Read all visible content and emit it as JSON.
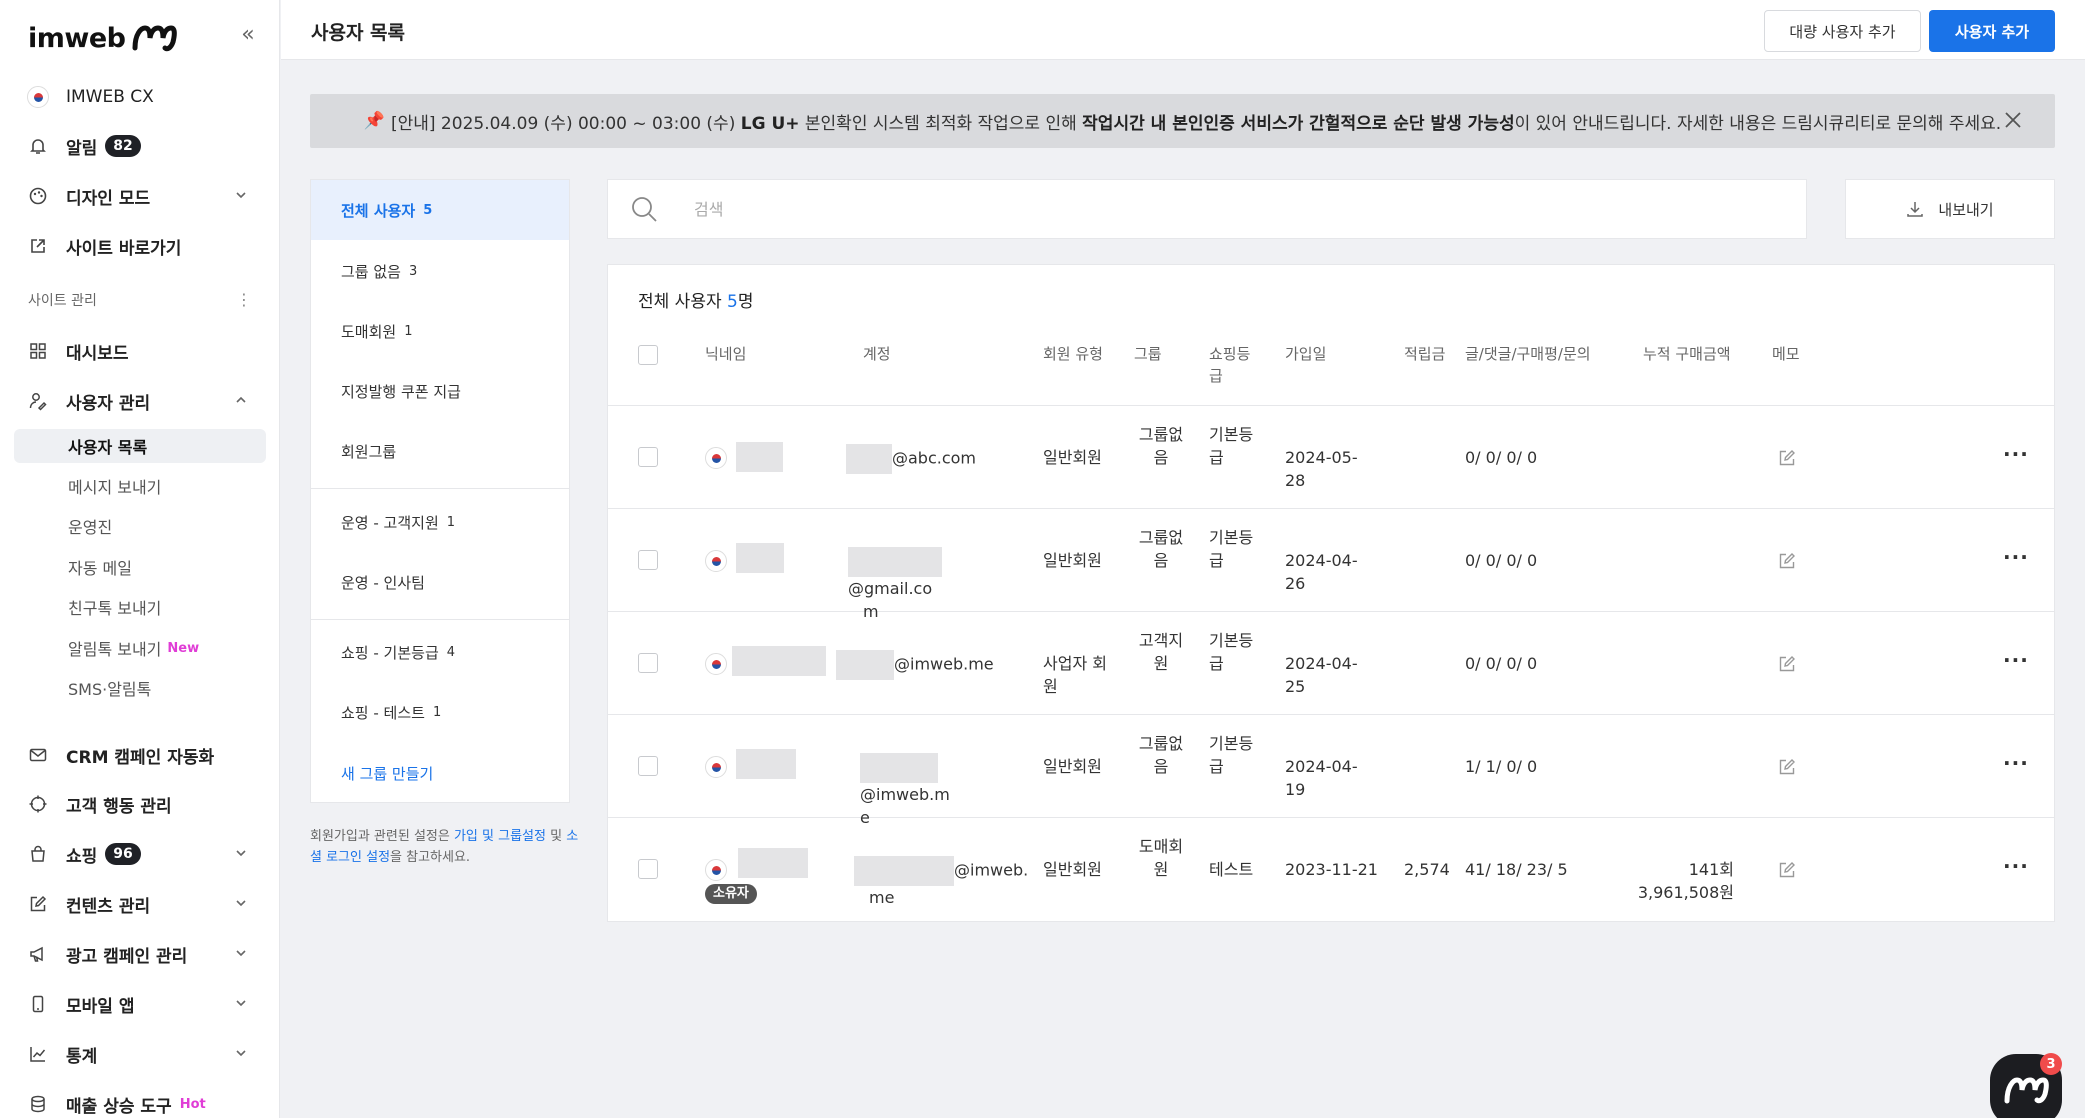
{
  "app": {
    "brand": "imweb",
    "site_name": "IMWEB CX"
  },
  "sidebar": {
    "alarm": {
      "label": "알림",
      "count": "82"
    },
    "design_mode": "디자인 모드",
    "site_shortcut": "사이트 바로가기",
    "section_label": "사이트 관리",
    "dashboard": "대시보드",
    "user_mgmt": "사용자 관리",
    "sub_items": [
      {
        "label": "사용자 목록"
      },
      {
        "label": "메시지 보내기"
      },
      {
        "label": "운영진"
      },
      {
        "label": "자동 메일"
      },
      {
        "label": "친구톡 보내기"
      },
      {
        "label": "알림톡 보내기",
        "tag": "New"
      },
      {
        "label": "SMS·알림톡"
      }
    ],
    "crm": "CRM 캠페인 자동화",
    "behavior": "고객 행동 관리",
    "shopping": {
      "label": "쇼핑",
      "count": "96"
    },
    "content": "컨텐츠 관리",
    "ads": "광고 캠페인 관리",
    "mobile": "모바일 앱",
    "stats": "통계",
    "sales": {
      "label": "매출 상승 도구",
      "tag": "Hot"
    }
  },
  "header": {
    "title": "사용자 목록",
    "bulk_add": "대량 사용자 추가",
    "add_user": "사용자 추가"
  },
  "notice": {
    "pin": "📌",
    "part1": "[안내] 2025.04.09 (수) 00:00 ~ 03:00 (수) ",
    "part2": "LG U+",
    "part3": " 본인확인 시스템 최적화 작업으로 인해 ",
    "part4": "작업시간 내 본인인증 서비스가 간헐적으로 순단 발생 가능성",
    "part5": "이 있어 안내드립니다. 자세한 내용은 드림시큐리티로 문의해 주세요."
  },
  "groups": {
    "items": [
      {
        "label": "전체 사용자",
        "count": "5"
      },
      {
        "label": "그룹 없음",
        "count": "3"
      },
      {
        "label": "도매회원",
        "count": "1"
      },
      {
        "label": "지정발행 쿠폰 지급",
        "count": ""
      },
      {
        "label": "회원그룹",
        "count": ""
      },
      {
        "label": "운영 - 고객지원",
        "count": "1"
      },
      {
        "label": "운영 - 인사팀",
        "count": ""
      },
      {
        "label": "쇼핑 - 기본등급",
        "count": "4"
      },
      {
        "label": "쇼핑 - 테스트",
        "count": "1"
      }
    ],
    "new_group": "새 그룹 만들기",
    "help": {
      "p1": "회원가입과 관련된 설정은 ",
      "link1": "가입 및 그룹설정",
      "p2": " 및 ",
      "link2": "소셜 로그인 설정",
      "p3": "을 참고하세요."
    }
  },
  "search": {
    "placeholder": "검색"
  },
  "export": {
    "label": "내보내기"
  },
  "table": {
    "title_prefix": "전체 사용자 ",
    "count": "5",
    "title_suffix": "명",
    "headers": {
      "nickname": "닉네임",
      "account": "계정",
      "member_type": "회원 유형",
      "group": "그룹",
      "shop_grade": "쇼핑등급",
      "joined": "가입일",
      "points": "적립금",
      "posts": "글/댓글/구매평/문의",
      "total_purchase": "누적 구매금액",
      "memo": "메모"
    },
    "rows": [
      {
        "account_suffix": "@abc.com",
        "account_wrap": "",
        "member_type": "일반회원",
        "group": "그룹없음",
        "grade": "기본등급",
        "joined": "2024-05-28",
        "points": "",
        "posts": "0/ 0/ 0/ 0",
        "purchase_count": "",
        "purchase_amount": "",
        "owner": ""
      },
      {
        "account_suffix": "@gmail.co",
        "account_wrap": "m",
        "member_type": "일반회원",
        "group": "그룹없음",
        "grade": "기본등급",
        "joined": "2024-04-26",
        "points": "",
        "posts": "0/ 0/ 0/ 0",
        "purchase_count": "",
        "purchase_amount": "",
        "owner": ""
      },
      {
        "account_suffix": "@imweb.me",
        "account_wrap": "",
        "member_type": "사업자 회원",
        "group": "고객지원",
        "grade": "기본등급",
        "joined": "2024-04-25",
        "points": "",
        "posts": "0/ 0/ 0/ 0",
        "purchase_count": "",
        "purchase_amount": "",
        "owner": ""
      },
      {
        "account_suffix": "@imweb.m",
        "account_wrap": "e",
        "member_type": "일반회원",
        "group": "그룹없음",
        "grade": "기본등급",
        "joined": "2024-04-19",
        "points": "",
        "posts": "1/ 1/ 0/ 0",
        "purchase_count": "",
        "purchase_amount": "",
        "owner": ""
      },
      {
        "account_suffix": "@imweb.",
        "account_wrap": "me",
        "member_type": "일반회원",
        "group": "도매회원",
        "grade": "테스트",
        "joined": "2023-11-21",
        "points": "2,574",
        "posts": "41/ 18/ 23/ 5",
        "purchase_count": "141회",
        "purchase_amount": "3,961,508원",
        "owner": "소유자"
      }
    ]
  },
  "chat_fab": {
    "badge": "3"
  },
  "colors": {
    "accent": "#1a73e8",
    "tag_pink": "#e03dd6"
  }
}
